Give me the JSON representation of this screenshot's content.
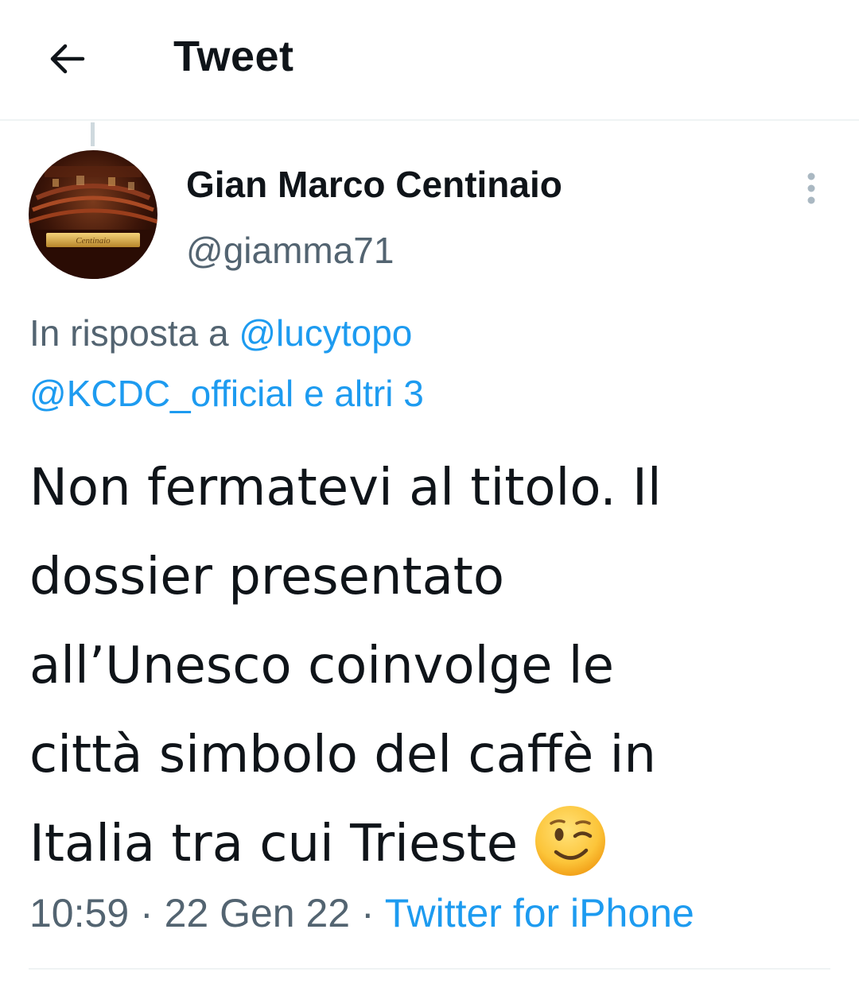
{
  "header": {
    "title": "Tweet",
    "back_icon": "arrow-left-icon"
  },
  "author": {
    "display_name": "Gian Marco Centinaio",
    "handle": "@giamma71",
    "avatar_plate_text": "Centinaio"
  },
  "reply_context": {
    "prefix": "In risposta a",
    "mention_1": "@lucytopo",
    "mention_2": "@KCDC_official",
    "others": "e altri 3"
  },
  "tweet": {
    "lines": [
      "Non fermatevi al titolo. Il",
      "dossier presentato",
      "all’Unesco coinvolge le",
      "città simbolo del caffè in",
      "Italia tra cui Trieste"
    ],
    "emoji": "winking-face"
  },
  "meta": {
    "time": "10:59",
    "separator": "·",
    "date": "22 Gen 22",
    "source": "Twitter for iPhone"
  },
  "colors": {
    "accent": "#1d9bf0",
    "secondary_text": "#536471",
    "primary_text": "#0f1419",
    "divider": "#eff3f4"
  }
}
